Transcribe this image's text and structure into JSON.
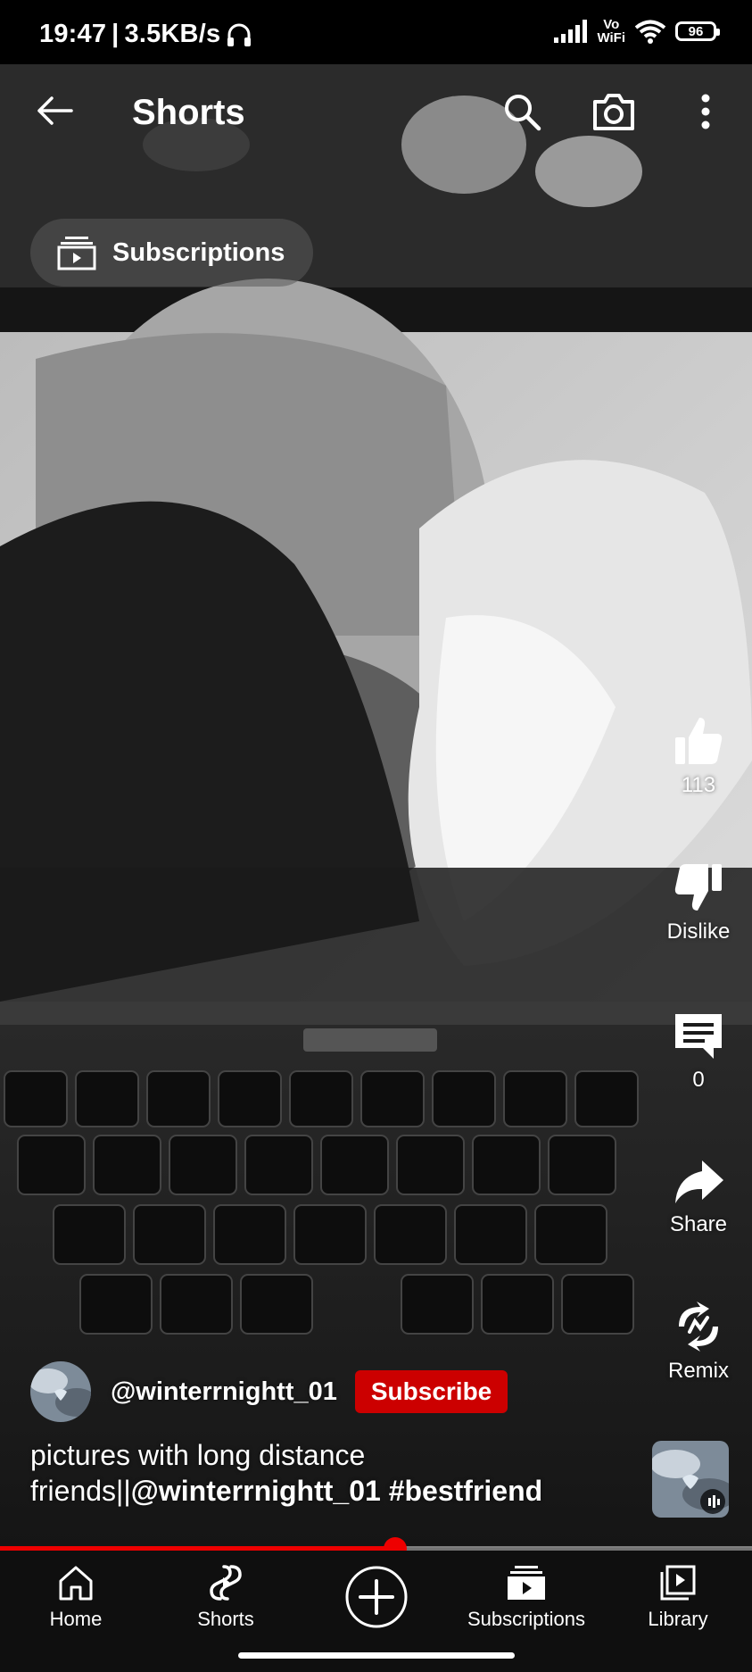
{
  "status_bar": {
    "time": "19:47",
    "network_speed": "3.5KB/s",
    "vowifi_top": "Vo",
    "vowifi_bottom": "WiFi",
    "battery": "96"
  },
  "header": {
    "title": "Shorts",
    "icons": [
      "back-arrow-icon",
      "search-icon",
      "camera-icon",
      "more-vert-icon"
    ]
  },
  "feed_chip": {
    "label": "Subscriptions",
    "icon": "subscriptions-icon"
  },
  "actions": {
    "like": {
      "icon": "thumb-up-icon",
      "label": "113"
    },
    "dislike": {
      "icon": "thumb-down-icon",
      "label": "Dislike"
    },
    "comments": {
      "icon": "comment-icon",
      "label": "0"
    },
    "share": {
      "icon": "share-icon",
      "label": "Share"
    },
    "remix": {
      "icon": "remix-icon",
      "label": "Remix"
    }
  },
  "channel": {
    "handle": "@winterrnightt_01",
    "subscribe_label": "Subscribe"
  },
  "caption": {
    "text": "pictures with long distance friends||",
    "mention": "@winterrnightt_01",
    "hashtag": "#bestfriend"
  },
  "progress": {
    "played_fraction": 0.526
  },
  "bottom_nav": {
    "items": [
      {
        "label": "Home",
        "icon": "home-icon"
      },
      {
        "label": "Shorts",
        "icon": "shorts-icon"
      },
      {
        "label": "",
        "icon": "create-plus-icon"
      },
      {
        "label": "Subscriptions",
        "icon": "subscriptions-icon"
      },
      {
        "label": "Library",
        "icon": "library-icon"
      }
    ]
  },
  "colors": {
    "accent_red": "#cc0000",
    "progress_red": "#ee0000",
    "nav_background": "#0f0f0f"
  }
}
